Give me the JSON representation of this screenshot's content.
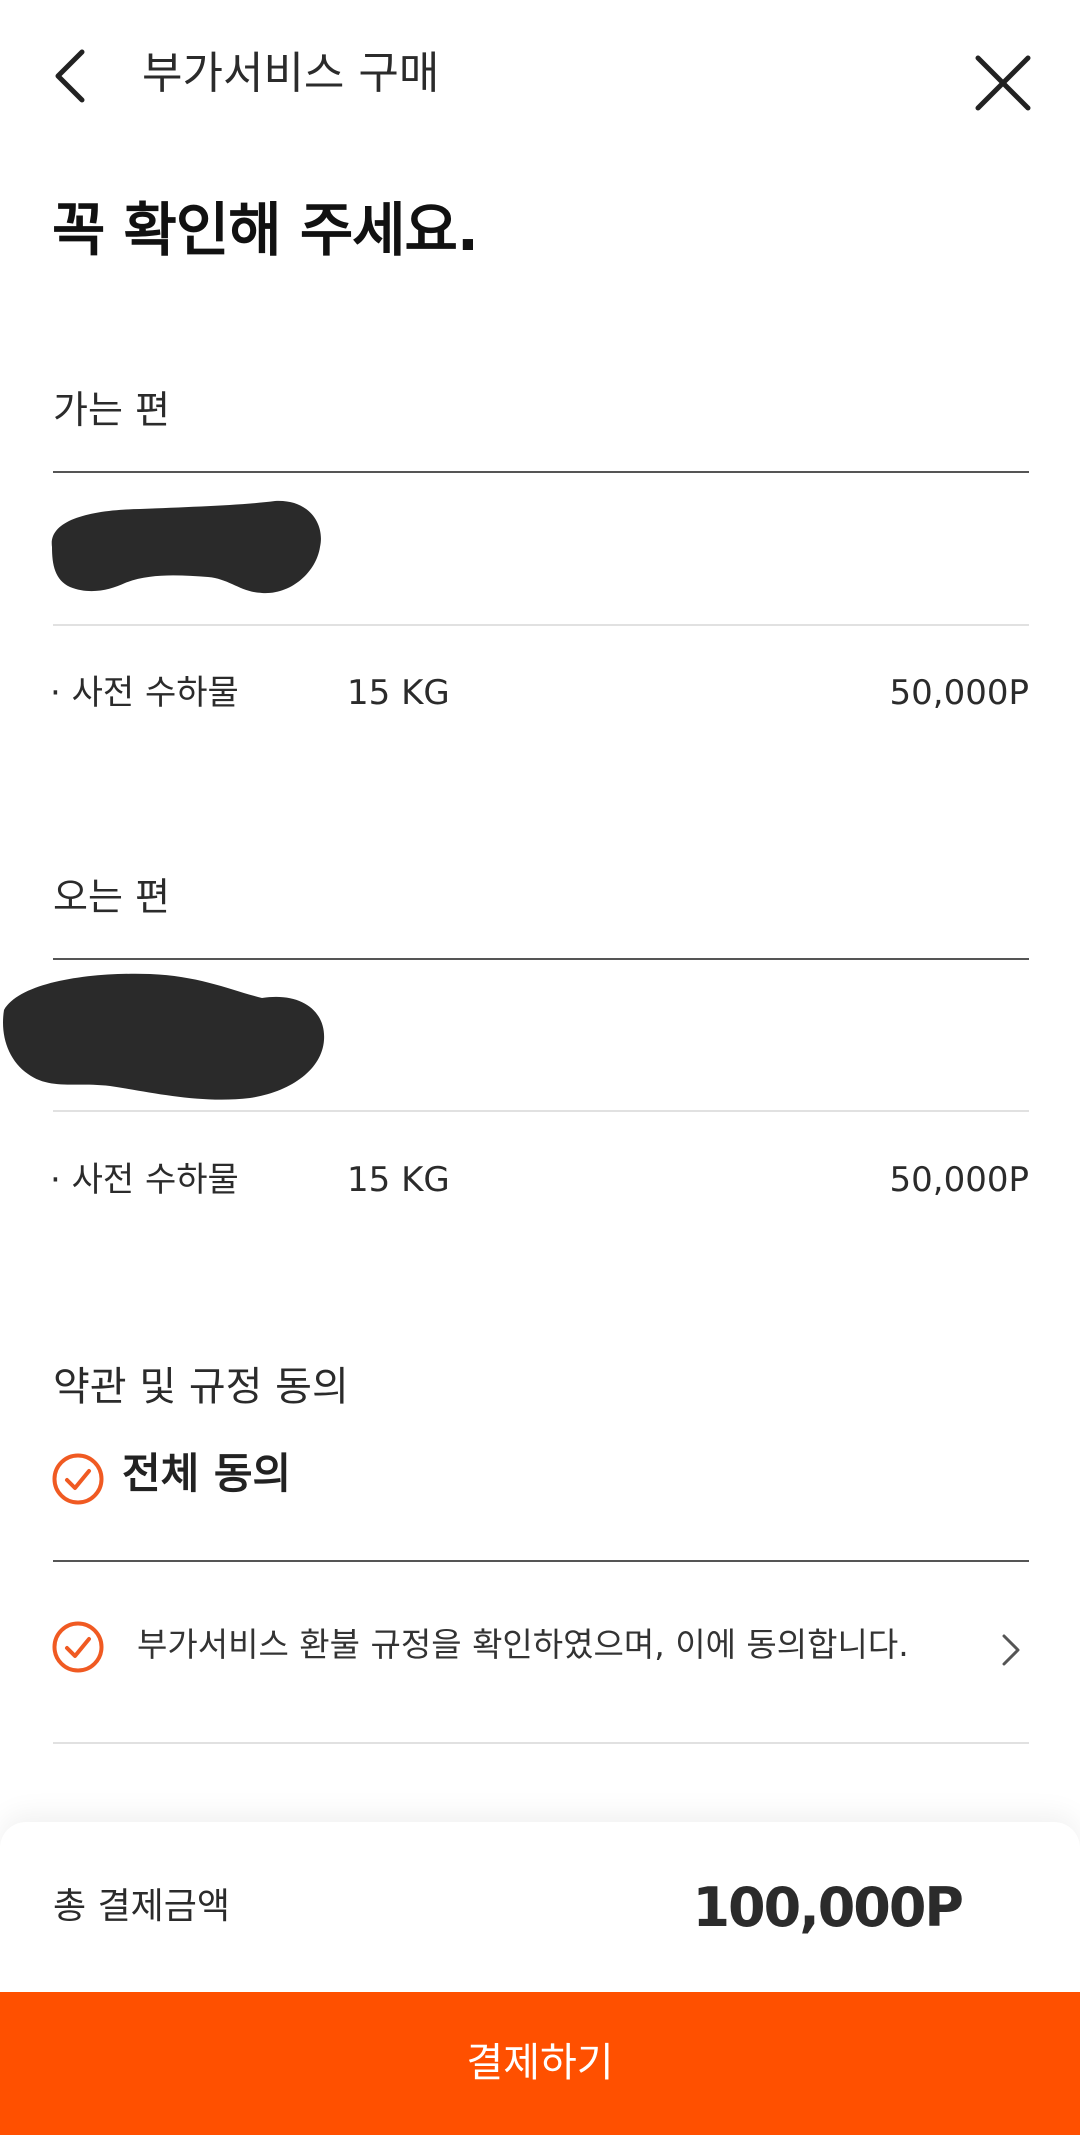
{
  "header": {
    "title": "부가서비스 구매",
    "back_icon": "chevron-left-icon",
    "close_icon": "close-icon"
  },
  "notice": {
    "title_line2": "꼭 확인해 주세요."
  },
  "outbound": {
    "label": "가는 편",
    "item_name": "· 사전 수하물",
    "item_weight": "15 KG",
    "item_price": "50,000P"
  },
  "inbound": {
    "label": "오는 편",
    "item_name": "· 사전 수하물",
    "item_weight": "15 KG",
    "item_price": "50,000P"
  },
  "terms": {
    "title": "약관 및 규정 동의",
    "agree_all": "전체 동의",
    "agree_refund": "부가서비스 환불 규정을 확인하였으며, 이에 동의합니다.",
    "agree_all_checked": true,
    "agree_refund_checked": true
  },
  "summary": {
    "total_label": "총 결제금액",
    "total_amount": "100,000P"
  },
  "actions": {
    "pay_label": "결제하기"
  },
  "colors": {
    "accent": "#ff5000",
    "check": "#f05a22",
    "text": "#2b2b2b",
    "redaction": "#2a2a2a"
  }
}
